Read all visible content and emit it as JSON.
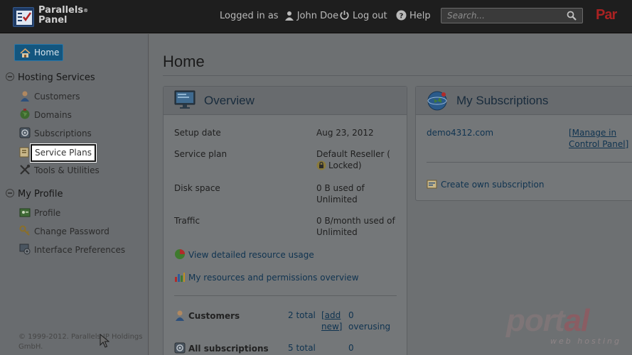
{
  "header": {
    "brand_line1": "Parallels",
    "brand_line2": "Panel",
    "brand_reg": "®",
    "logged_in_label": "Logged in as",
    "user_name": "John Doe",
    "logout_label": "Log out",
    "help_label": "Help",
    "search_placeholder": "Search...",
    "brand_right": "Par"
  },
  "sidebar": {
    "home_label": "Home",
    "hosting_section": "Hosting Services",
    "hosting_items": [
      "Customers",
      "Domains",
      "Subscriptions",
      "Service Plans",
      "Tools & Utilities"
    ],
    "profile_section": "My Profile",
    "profile_items": [
      "Profile",
      "Change Password",
      "Interface Preferences"
    ],
    "copyright": "© 1999-2012. Parallels IP Holdings GmbH."
  },
  "main": {
    "title": "Home",
    "overview": {
      "title": "Overview",
      "rows": [
        {
          "label": "Setup date",
          "value": "Aug 23, 2012"
        },
        {
          "label": "Service plan",
          "value": "Default Reseller (",
          "value_extra": "Locked)"
        },
        {
          "label": "Disk space",
          "value": "0 B used of Unlimited"
        },
        {
          "label": "Traffic",
          "value": "0 B/month used of Unlimited"
        }
      ],
      "link_usage": "View detailed resource usage",
      "link_perms": "My resources and permissions overview",
      "customers_label": "Customers",
      "customers_total": "2 total",
      "customers_add": "[add new]",
      "customers_overusing_count": "0",
      "customers_overusing": "overusing",
      "subs_label": "All subscriptions",
      "subs_total": "5 total",
      "subs_count": "0"
    },
    "my_subscriptions": {
      "title": "My Subscriptions",
      "domain": "demo4312.com",
      "manage_link": "[Manage in Control Panel]",
      "create_link": "Create own subscription"
    }
  },
  "watermark": {
    "text_a": "port",
    "text_b": "al",
    "sub": "web hosting"
  }
}
